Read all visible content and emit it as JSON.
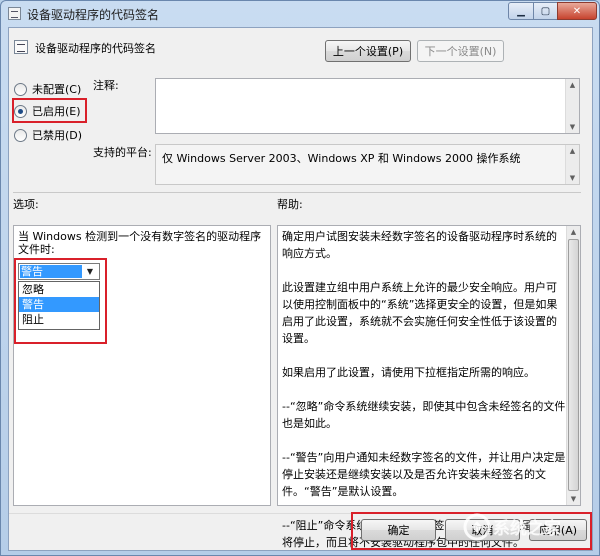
{
  "window": {
    "title": "设备驱动程序的代码签名"
  },
  "header": {
    "title": "设备驱动程序的代码签名",
    "prev_button": "上一个设置(P)",
    "next_button": "下一个设置(N)"
  },
  "state_options": {
    "not_configured": "未配置(C)",
    "enabled": "已启用(E)",
    "disabled": "已禁用(D)",
    "selected": "enabled"
  },
  "comment": {
    "label": "注释:",
    "value": ""
  },
  "supported_on": {
    "label": "支持的平台:",
    "value": "仅 Windows Server 2003、Windows XP 和 Windows 2000 操作系统"
  },
  "options": {
    "label": "选项:",
    "description": "当 Windows 检测到一个没有数字签名的驱动程序文件时:",
    "selected": "警告",
    "dropdown_items": [
      "忽略",
      "警告",
      "阻止"
    ],
    "highlighted_index": 1
  },
  "help": {
    "label": "帮助:",
    "text": "确定用户试图安装未经数字签名的设备驱动程序时系统的响应方式。\n\n此设置建立组中用户系统上允许的最少安全响应。用户可以使用控制面板中的“系统”选择更安全的设置，但是如果启用了此设置，系统就不会实施任何安全性低于该设置的设置。\n\n如果启用了此设置，请使用下拉框指定所需的响应。\n\n--“忽略”命令系统继续安装，即使其中包含未经签名的文件也是如此。\n\n--“警告”向用户通知未经数字签名的文件，并让用户决定是停止安装还是继续安装以及是否允许安装未经签名的文件。“警告”是默认设置。\n\n--“阻止”命令系统拒绝安装未经签名的文件。结果是，安装将停止，而且将不安装驱动程序包中的任何文件。"
  },
  "footer": {
    "ok": "确定",
    "cancel": "取消",
    "apply": "应用(A)"
  },
  "watermark": {
    "text": "系统之家"
  },
  "colors": {
    "highlight": "#3399ff",
    "annotation_red": "#d9202a"
  }
}
